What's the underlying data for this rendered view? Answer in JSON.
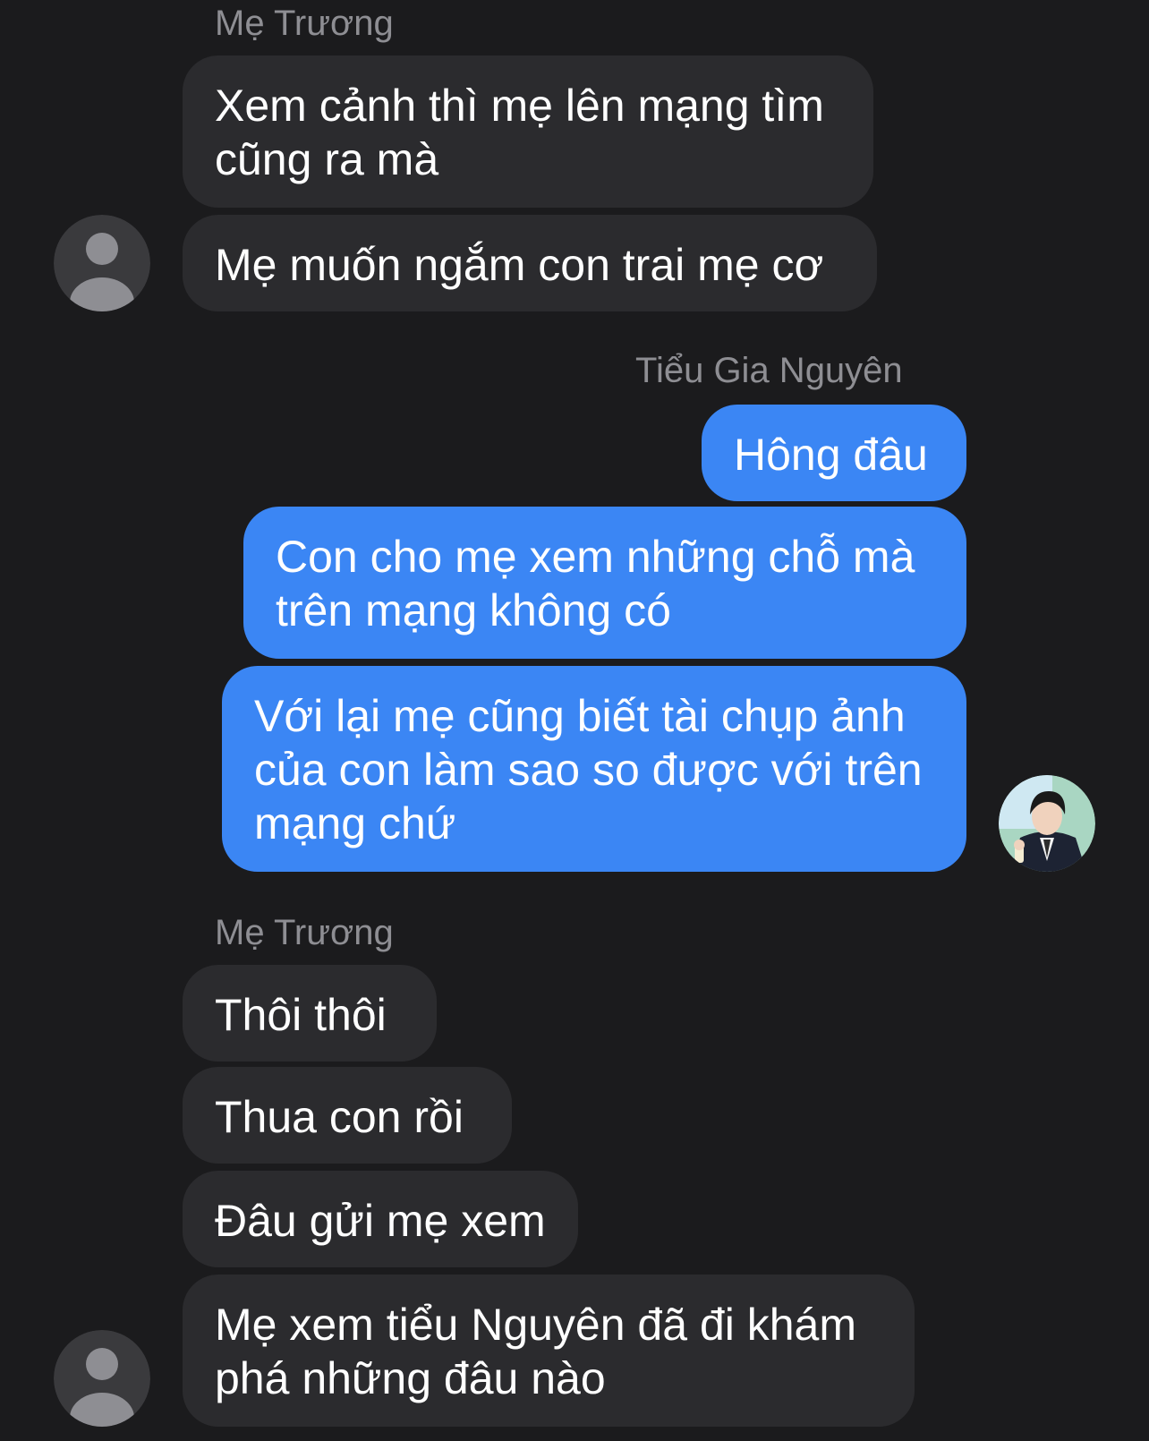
{
  "messages": {
    "group1": {
      "sender": "Mẹ Trương",
      "bubbles": [
        {
          "line1": "Xem cảnh thì mẹ lên mạng tìm",
          "line2": "cũng ra mà"
        },
        {
          "line1": "Mẹ muốn ngắm con trai mẹ cơ"
        }
      ]
    },
    "group2": {
      "sender": "Tiểu Gia Nguyên",
      "bubbles": [
        {
          "line1": "Hông đâu"
        },
        {
          "line1": "Con cho mẹ xem những chỗ mà",
          "line2": "trên mạng không có"
        },
        {
          "line1": "Với lại mẹ cũng biết tài chụp ảnh",
          "line2": "của con làm sao so được với trên",
          "line3": "mạng chứ"
        }
      ]
    },
    "group3": {
      "sender": "Mẹ Trương",
      "bubbles": [
        {
          "line1": "Thôi thôi"
        },
        {
          "line1": "Thua con rồi"
        },
        {
          "line1": "Đâu gửi mẹ xem"
        },
        {
          "line1": "Mẹ xem tiểu Nguyên đã đi khám",
          "line2": "phá những đâu nào"
        }
      ]
    }
  },
  "colors": {
    "background": "#1b1b1d",
    "incoming_bubble": "#2b2b2e",
    "outgoing_bubble": "#3b86f4",
    "sender_name": "#8e8e93"
  },
  "icons": {
    "default_avatar": "person-silhouette-icon",
    "user_avatar": "profile-photo-avatar"
  }
}
